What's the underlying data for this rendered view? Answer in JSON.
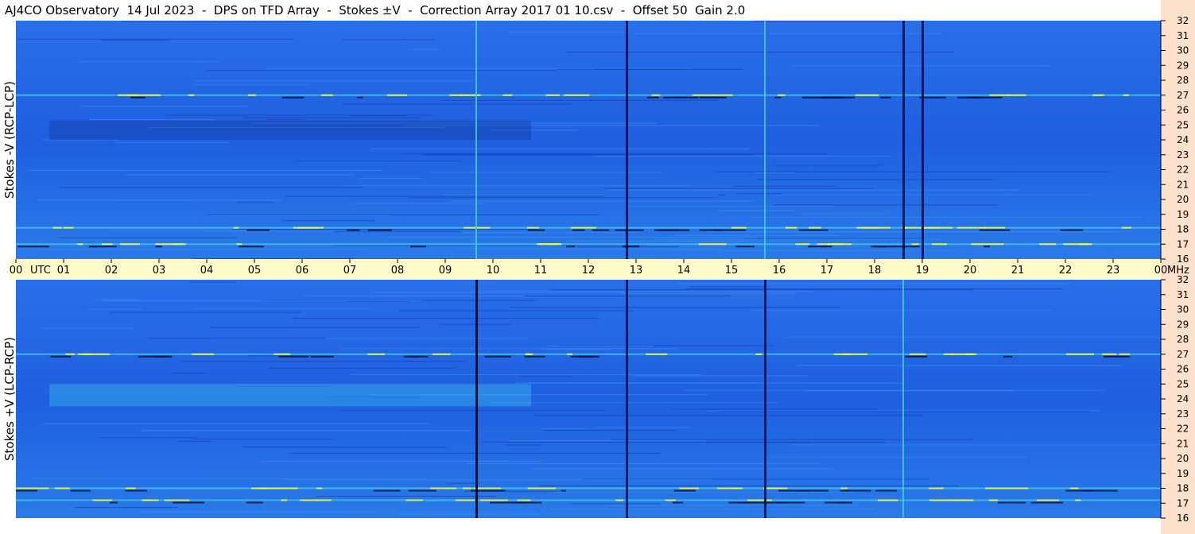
{
  "title": "AJ4CO Observatory  14 Jul 2023  -  DPS on TFD Array  -  Stokes ±V  -  Correction Array 2017 01 10.csv  -  Offset 50  Gain 2.0",
  "panels": {
    "top_label": "Stokes -V (RCP-LCP)",
    "bottom_label": "Stokes +V (LCP-RCP)"
  },
  "time_axis": {
    "labels": [
      "00",
      "01",
      "02",
      "03",
      "04",
      "05",
      "06",
      "07",
      "08",
      "09",
      "10",
      "11",
      "12",
      "13",
      "14",
      "15",
      "16",
      "17",
      "18",
      "19",
      "20",
      "21",
      "22",
      "23",
      "00"
    ],
    "utc_label": "UTC",
    "mhz_label": "MHz"
  },
  "colors": {
    "base": "#1f5fe0",
    "dark": "#0a1f7a",
    "light": "#3fd0ea",
    "hot": "#e8ff40",
    "axis_bg": "#fffac8",
    "right_bg": "#fde1cd"
  },
  "chart_data": {
    "type": "heatmap",
    "title": "AJ4CO Observatory  14 Jul 2023  -  DPS on TFD Array  -  Stokes ±V  -  Correction Array 2017 01 10.csv  -  Offset 50  Gain 2.0",
    "xlabel": "UTC",
    "ylabel_units": "MHz",
    "x_range_hours": [
      0,
      24
    ],
    "y_range_mhz": [
      16,
      32
    ],
    "y_ticks": [
      32,
      31,
      30,
      29,
      28,
      27,
      26,
      25,
      24,
      23,
      22,
      21,
      20,
      19,
      18,
      17,
      16
    ],
    "panels": [
      {
        "name": "Stokes -V (RCP-LCP)",
        "dark_vertical_lines_utc": [
          12.8,
          18.6,
          19.0
        ],
        "bright_vertical_lines_utc": [
          9.65,
          15.7
        ],
        "bright_horizontal_bands_mhz": [
          17.0,
          18.1,
          27.0
        ],
        "dark_region": {
          "x": [
            0.7,
            10.8
          ],
          "y_mhz": [
            24.0,
            25.3
          ]
        }
      },
      {
        "name": "Stokes +V (LCP-RCP)",
        "dark_vertical_lines_utc": [
          9.65,
          12.8,
          15.7
        ],
        "bright_vertical_lines_utc": [
          12.8,
          18.6
        ],
        "bright_horizontal_bands_mhz": [
          17.2,
          18.0,
          27.0
        ],
        "bright_region": {
          "x": [
            0.7,
            10.8
          ],
          "y_mhz": [
            23.5,
            25.0
          ]
        }
      }
    ]
  }
}
